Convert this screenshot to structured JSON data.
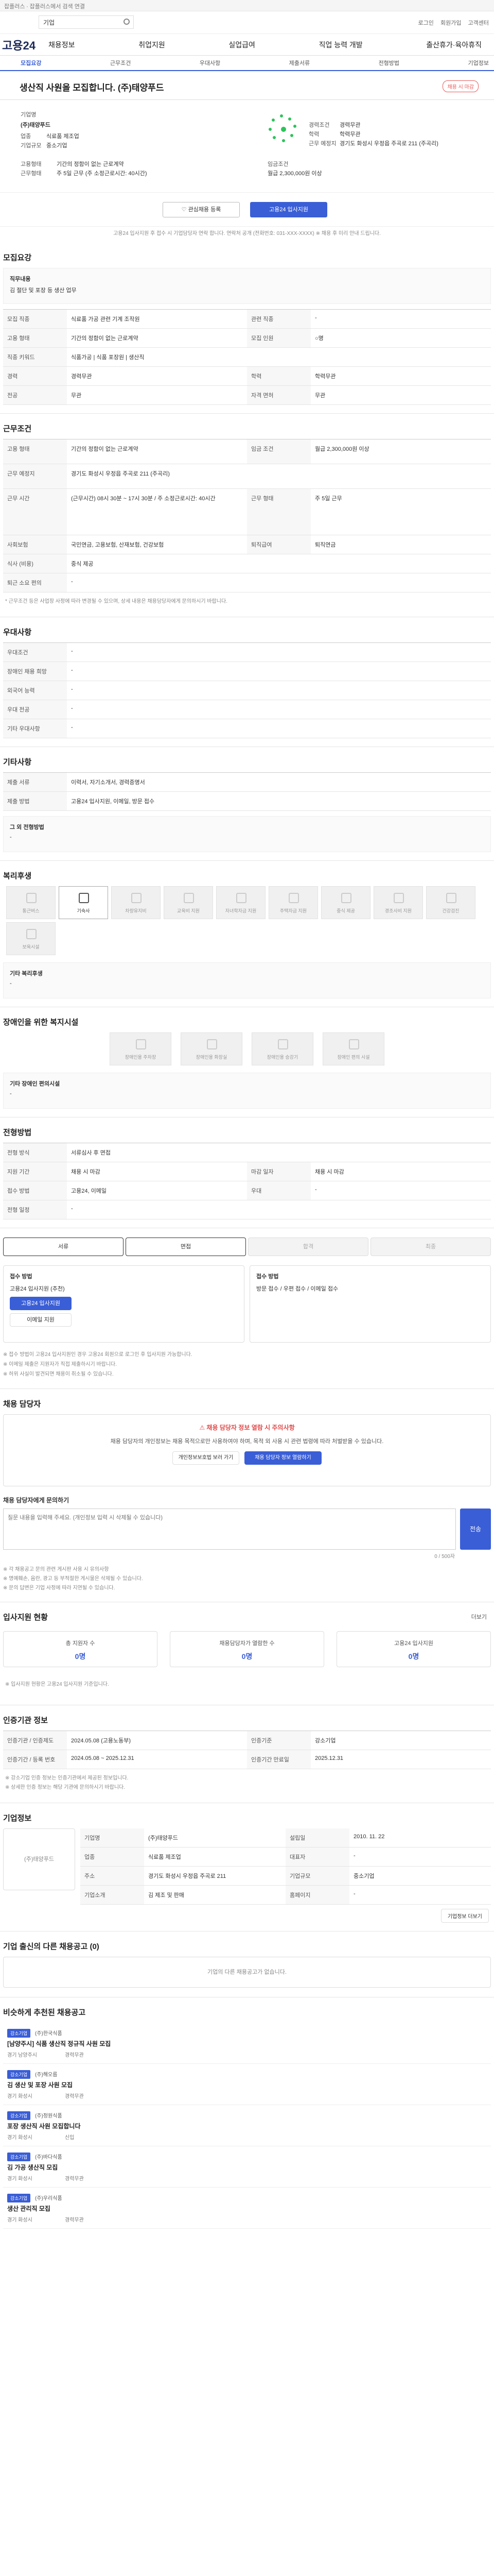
{
  "topbar": {
    "text": "잡플러스 ∙ 잡플러스에서 검색 연결"
  },
  "search": {
    "placeholder": "검색어를 입력하세요",
    "value": "기업"
  },
  "util": {
    "items": [
      "로그인",
      "회원가입",
      "고객센터"
    ]
  },
  "gnb": {
    "logo": "고용24",
    "menu": [
      "채용정보",
      "취업지원",
      "실업급여",
      "직업 능력 개발",
      "출산휴가·육아휴직"
    ]
  },
  "tabs": [
    "모집요강",
    "근무조건",
    "우대사항",
    "제출서류",
    "전형방법",
    "기업정보"
  ],
  "job": {
    "title": "생산직 사원을 모집합니다. (주)태양푸드",
    "status": "채용 시 마감"
  },
  "corp": {
    "label_corp": "기업명",
    "name": "(주)태양푸드",
    "label_industry": "업종",
    "industry": "식료품 제조업",
    "label_size": "기업규모",
    "size": "중소기업",
    "label_addr": "근무지역",
    "addr": "경기도 화성시 (우정읍)",
    "label_employ": "고용형태",
    "employ": "기간의 정함이 없는 근로계약",
    "label_type": "근무형태",
    "type": "주 5일 근무 (주 소정근로시간: 40시간)",
    "label_career": "경력조건",
    "career": "경력무관",
    "label_edu": "학력",
    "edu": "학력무관",
    "label_pay": "임금조건",
    "pay": "월급 2,300,000원 이상",
    "label_place": "근무 예정지",
    "place": "경기도 화성시 우정읍 주곡로 211 (주곡리)"
  },
  "actions": {
    "save": "관심채용 등록",
    "apply": "고용24 입사지원"
  },
  "notes": {
    "apply_note": "고용24 입사지원 후 접수 시 기업담당자 연락 합니다. 연락처 공개 (전화번호: 031-XXX-XXXX) ※ 채용 후 미리 안내 드립니다.",
    "footer_note": "※ 자격증 등의 기입 순서는 관계 없습니다."
  },
  "sections": {
    "recruit": "모집요강",
    "work": "근무조건",
    "pref": "우대사항",
    "docs": "기타사항",
    "welfare": "복리후생",
    "disabled": "장애인을 위한 복지시설",
    "process": "전형방법",
    "contact": "채용 담당자",
    "apply_status": "입사지원 현황",
    "corp_info": "기업정보",
    "other_jobs": "인증기관 정보",
    "more_jobs": "기업 출신의 다른 채용공고 (0)",
    "recommend": "비슷하게 추천된 채용공고"
  },
  "recruit": {
    "intro_label": "직무내용",
    "intro": "김 절단 및 포장 등 생산 업무",
    "rows": [
      [
        "모집 직종",
        "식료품 가공 관련 기계 조작원",
        "관련 직종",
        "-"
      ],
      [
        "고용 형태",
        "기간의 정함이 없는 근로계약",
        "모집 인원",
        "○명"
      ],
      [
        "직종 키워드",
        "식품가공 | 식품 포장원 | 생산직"
      ],
      [
        "경력",
        "경력무관",
        "학력",
        "학력무관"
      ],
      [
        "전공",
        "무관",
        "자격 면허",
        "무관"
      ]
    ]
  },
  "work": {
    "rows": [
      [
        "고용 형태",
        "기간의 정함이 없는 근로계약",
        "임금 조건",
        "월급 2,300,000원 이상"
      ],
      [
        "근무 예정지",
        "경기도 화성시 우정읍 주곡로 211 (주곡리)"
      ],
      [
        "근무 시간",
        "(근무시간) 08시 30분 ~ 17시 30분 / 주 소정근로시간: 40시간",
        "근무 형태",
        "주 5일 근무"
      ],
      [
        "사회보험",
        "국민연금, 고용보험, 산재보험, 건강보험",
        "퇴직급여",
        "퇴직연금"
      ],
      [
        "식사 (비용)",
        "중식 제공"
      ],
      [
        "퇴근 소요 편의",
        "-"
      ]
    ],
    "note": "* 근무조건 등은 사업장 사정에 따라 변경될 수 있으며, 상세 내용은 채용담당자에게 문의하시기 바랍니다."
  },
  "pref": {
    "rows": [
      [
        "우대조건",
        "-"
      ],
      [
        "장애인 채용 희망",
        "-"
      ],
      [
        "외국어 능력",
        "-"
      ],
      [
        "우대 전공",
        "-"
      ],
      [
        "기타 우대사항",
        "-"
      ]
    ]
  },
  "docs": {
    "rows": [
      [
        "제출 서류",
        "이력서, 자기소개서, 경력증명서"
      ],
      [
        "제출 방법",
        "고용24 입사지원, 이메일, 방문 접수"
      ]
    ],
    "extra_label": "그 외 전형방법",
    "extra": "-"
  },
  "welfare": {
    "items": [
      {
        "label": "통근버스",
        "on": false
      },
      {
        "label": "기숙사",
        "on": true
      },
      {
        "label": "차량유지비",
        "on": false
      },
      {
        "label": "교육비 지원",
        "on": false
      },
      {
        "label": "자녀학자금 지원",
        "on": false
      },
      {
        "label": "주택자금 지원",
        "on": false
      },
      {
        "label": "중식 제공",
        "on": false
      },
      {
        "label": "경조사비 지원",
        "on": false
      },
      {
        "label": "건강검진",
        "on": false
      },
      {
        "label": "보육시설",
        "on": false
      }
    ],
    "extra_label": "기타 복리후생",
    "extra": "-"
  },
  "disabled": {
    "items": [
      {
        "label": "장애인용 주차장"
      },
      {
        "label": "장애인용 화장실"
      },
      {
        "label": "장애인용 승강기"
      },
      {
        "label": "장애인 편의 시설"
      }
    ],
    "extra_label": "기타 장애인 편의시설",
    "extra": "-"
  },
  "process": {
    "rows": [
      [
        "전형 방식",
        "서류심사 후 면접"
      ],
      [
        "지원 기간",
        "채용 시 마감",
        "마감 일자",
        "채용 시 마감"
      ],
      [
        "접수 방법",
        "고용24, 이메일",
        "우대",
        "-"
      ],
      [
        "전형 일정",
        "-"
      ]
    ],
    "steps": [
      "서류",
      "면접",
      "합격",
      "최종"
    ],
    "apply_label": "접수 방법",
    "apply_desc": "고용24 입사지원 (추천)",
    "apply_btn": "고용24 입사지원",
    "email_btn": "이메일 지원",
    "doc_label": "접수 방법",
    "doc_desc": "방문 접수 / 우편 접수 / 이메일 접수",
    "notes": [
      "※ 접수 방법이 고용24 입사지원인 경우 고용24 회원으로 로그인 후 입사지원 가능합니다.",
      "※ 이메일 제출은 지원자가 직접 제출하시기 바랍니다.",
      "※ 허위 사실이 발견되면 채용이 취소될 수 있습니다."
    ]
  },
  "contact": {
    "badge": "채용 담당자 정보 열람 시 주의사항",
    "desc": "채용 담당자의 개인정보는 채용 목적으로만 사용하여야 하며, 목적 외 사용 시 관련 법령에 따라 처벌받을 수 있습니다.",
    "btn1": "개인정보보호법 보러 가기",
    "btn2": "채용 담당자 정보 열람하기",
    "inquiry_label": "채용 담당자에게 문의하기",
    "inquiry_placeholder": "질문 내용을 입력해 주세요. (개인정보 입력 시 삭제될 수 있습니다)",
    "inquiry_btn": "전송",
    "counter": "0 / 500자",
    "notes": [
      "※ 각 채용공고 문의 관련 게시판 사용 시 유의사항",
      "※ 명예훼손, 음란, 광고 등 부적절한 게시물은 삭제될 수 있습니다.",
      "※ 문의 답변은 기업 사정에 따라 지연될 수 있습니다."
    ]
  },
  "apply_status": {
    "more": "더보기",
    "cards": [
      {
        "t": "총 지원자 수",
        "n": "0명"
      },
      {
        "t": "채용담당자가 열람한 수",
        "n": "0명"
      },
      {
        "t": "고용24 입사지원",
        "n": "0명"
      }
    ],
    "note": "※ 입사지원 현황은 고용24 입사지원 기준입니다."
  },
  "cert": {
    "rows": [
      [
        "인증기관 / 인증제도",
        "2024.05.08 (고용노동부)",
        "인증기준",
        "강소기업"
      ],
      [
        "인증기간 / 등록 번호",
        "2024.05.08 ~ 2025.12.31",
        "인증기간 만료일",
        "2025.12.31"
      ]
    ],
    "notes": [
      "※ 강소기업 인증 정보는 인증기관에서 제공된 정보입니다.",
      "※ 상세한 인증 정보는 해당 기관에 문의하시기 바랍니다."
    ]
  },
  "corp_info": {
    "logo_caption": "(주)태양푸드",
    "rows": [
      [
        "기업명",
        "(주)태양푸드",
        "설립일",
        "2010. 11. 22"
      ],
      [
        "업종",
        "식료품 제조업",
        "대표자",
        "-"
      ],
      [
        "주소",
        "경기도 화성시 우정읍 주곡로 211",
        "기업규모",
        "중소기업"
      ],
      [
        "기업소개",
        "김 제조 및 판매",
        "홈페이지",
        "-"
      ]
    ],
    "btn": "기업정보 더보기"
  },
  "more_jobs": {
    "empty": "기업의 다른 채용공고가 없습니다."
  },
  "recommend": {
    "items": [
      {
        "tag": "강소기업",
        "company": "(주)한국식품",
        "title": "[남양주시] 식품 생산직 정규직 사원 모집",
        "loc": "경기 남양주시",
        "cond": "경력무관"
      },
      {
        "tag": "강소기업",
        "company": "(주)해오름",
        "title": "김 생산 및 포장 사원 모집",
        "loc": "경기 화성시",
        "cond": "경력무관"
      },
      {
        "tag": "강소기업",
        "company": "(주)정원식품",
        "title": "포장 생산직 사원 모집합니다",
        "loc": "경기 화성시",
        "cond": "신입"
      },
      {
        "tag": "강소기업",
        "company": "(주)바다식품",
        "title": "김 가공 생산직 모집",
        "loc": "경기 화성시",
        "cond": "경력무관"
      },
      {
        "tag": "강소기업",
        "company": "(주)우리식품",
        "title": "생산 관리직 모집",
        "loc": "경기 화성시",
        "cond": "경력무관"
      }
    ]
  }
}
